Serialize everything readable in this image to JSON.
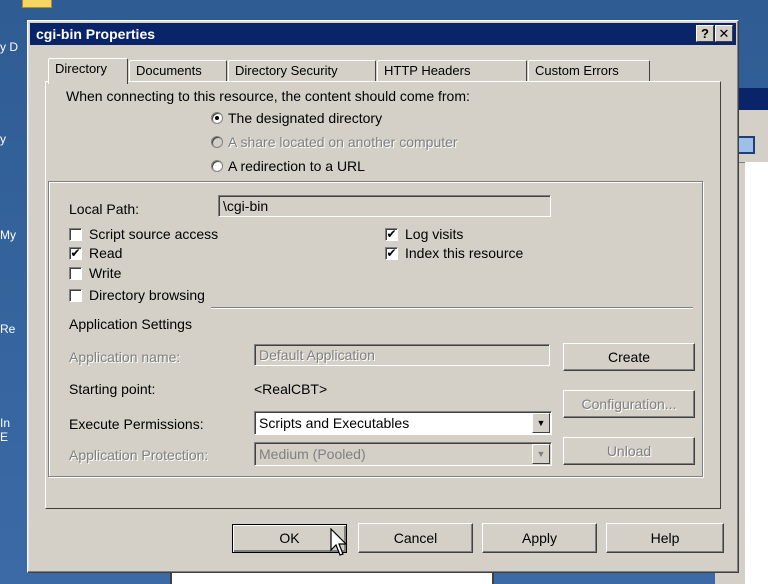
{
  "desktop": {
    "labels": [
      "y D",
      "y",
      "My",
      "Re",
      "In",
      "E"
    ]
  },
  "dialog": {
    "title": "cgi-bin Properties",
    "help_label": "?",
    "close_label": "✕",
    "tabs": [
      {
        "label": "Directory",
        "active": true
      },
      {
        "label": "Documents",
        "active": false
      },
      {
        "label": "Directory Security",
        "active": false
      },
      {
        "label": "HTTP Headers",
        "active": false
      },
      {
        "label": "Custom Errors",
        "active": false
      }
    ],
    "source_prompt": "When connecting to this resource, the content should come from:",
    "source_options": [
      {
        "label": "The designated directory",
        "selected": true,
        "enabled": true
      },
      {
        "label": "A share located on another computer",
        "selected": false,
        "enabled": false
      },
      {
        "label": "A redirection to a URL",
        "selected": false,
        "enabled": true
      }
    ],
    "local_path": {
      "label": "Local Path:",
      "value": "\\cgi-bin"
    },
    "checkboxes": [
      {
        "label": "Script source access",
        "checked": false
      },
      {
        "label": "Read",
        "checked": true
      },
      {
        "label": "Write",
        "checked": false
      },
      {
        "label": "Directory browsing",
        "checked": false
      },
      {
        "label": "Log visits",
        "checked": true
      },
      {
        "label": "Index this resource",
        "checked": true
      }
    ],
    "app_settings": {
      "heading": "Application Settings",
      "app_name_label": "Application name:",
      "app_name_value": "Default Application",
      "starting_point_label": "Starting point:",
      "starting_point_value": "<RealCBT>",
      "exec_perm_label": "Execute Permissions:",
      "exec_perm_value": "Scripts and Executables",
      "app_protection_label": "Application Protection:",
      "app_protection_value": "Medium (Pooled)",
      "create_label": "Create",
      "configuration_label": "Configuration...",
      "unload_label": "Unload"
    },
    "footer": {
      "ok_label": "OK",
      "cancel_label": "Cancel",
      "apply_label": "Apply",
      "help_label": "Help"
    }
  }
}
